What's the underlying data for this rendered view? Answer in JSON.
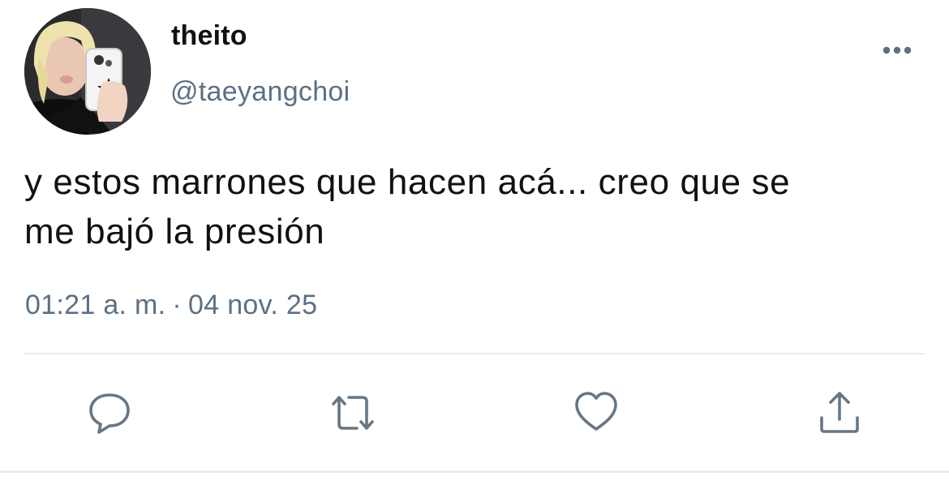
{
  "user": {
    "display_name": "theito",
    "handle": "@taeyangchoi"
  },
  "tweet": {
    "text": "y estos marrones que hacen acá... creo que se\nme bajó la presión",
    "time": "01:21 a. m.",
    "separator": "·",
    "date": "04 nov. 25"
  },
  "icons": {
    "more": "more-horizontal-icon",
    "reply": "reply-icon",
    "retweet": "retweet-icon",
    "like": "heart-icon",
    "share": "share-icon"
  },
  "colors": {
    "icon_gray": "#657786",
    "text_secondary": "#5b7083",
    "divider": "#e6ecf0"
  }
}
